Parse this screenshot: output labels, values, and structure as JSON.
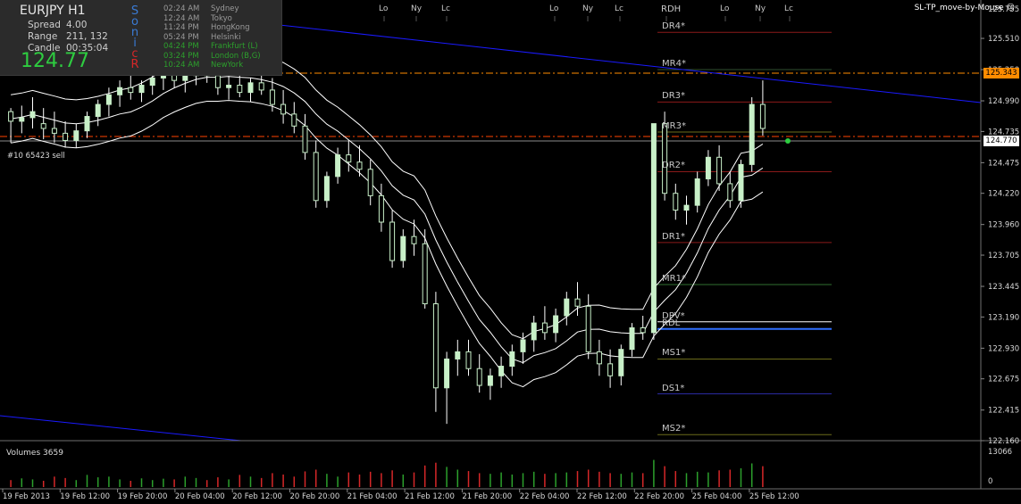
{
  "window": {
    "ea_name": "SL-TP_move-by-Mouse",
    "ea_icon": "smiley-icon"
  },
  "info_panel": {
    "symbol": "EURJPY  H1",
    "spread_label": "Spread",
    "spread_value": "4.00",
    "range_label": "Range",
    "range_value": "211, 132",
    "candle_label": "Candle",
    "candle_value": "00:35:04",
    "bid": "124.77",
    "sonic_letters": [
      {
        "ch": "S",
        "color": "#3a7bd5"
      },
      {
        "ch": "o",
        "color": "#3a7bd5"
      },
      {
        "ch": "n",
        "color": "#3a7bd5"
      },
      {
        "ch": "i",
        "color": "#3a7bd5"
      },
      {
        "ch": "c",
        "color": "#d62728"
      },
      {
        "ch": "R",
        "color": "#d62728"
      }
    ]
  },
  "sessions": [
    {
      "time": "02:24 AM",
      "city": "Sydney",
      "active": false
    },
    {
      "time": "12:24 AM",
      "city": "Tokyo",
      "active": false
    },
    {
      "time": "11:24 PM",
      "city": "HongKong",
      "active": false
    },
    {
      "time": "05:24 PM",
      "city": "Helsinki",
      "active": false
    },
    {
      "time": "04:24 PM",
      "city": "Frankfurt  (L)",
      "active": true
    },
    {
      "time": "03:24 PM",
      "city": "London  (B,G)",
      "active": true
    },
    {
      "time": "10:24 AM",
      "city": "NewYork",
      "active": true
    }
  ],
  "session_tags": [
    "Lo",
    "Ny",
    "Lc",
    "Lo",
    "Ny",
    "Lc",
    "RDH",
    "Lo",
    "Ny",
    "Lc"
  ],
  "order_label": "#10 65423 sell",
  "current_price_label": "124.770",
  "order_price_label": "125.343",
  "pivot_levels": [
    {
      "label": "DR4*",
      "price": 125.56,
      "color": "#8b1a1a"
    },
    {
      "label": "MR4*",
      "price": 125.25,
      "color": "#2f4f2f"
    },
    {
      "label": "DR3*",
      "price": 124.98,
      "color": "#8b1a1a"
    },
    {
      "label": "MR3*",
      "price": 124.73,
      "color": "#6b6b1a"
    },
    {
      "label": "DR2*",
      "price": 124.4,
      "color": "#8b1a1a"
    },
    {
      "label": "DR1*",
      "price": 123.81,
      "color": "#8b1a1a"
    },
    {
      "label": "MR1*",
      "price": 123.46,
      "color": "#2f6f2f"
    },
    {
      "label": "DPV*",
      "price": 123.15,
      "color": "#ffffff"
    },
    {
      "label": "RDL",
      "price": 123.09,
      "color": "#2f6fff"
    },
    {
      "label": "MS1*",
      "price": 122.84,
      "color": "#6b6b1a"
    },
    {
      "label": "DS1*",
      "price": 122.55,
      "color": "#2a2aa0"
    },
    {
      "label": "MS2*",
      "price": 122.21,
      "color": "#6b6b1a"
    }
  ],
  "price_axis": [
    "125.755",
    "125.510",
    "125.250",
    "124.990",
    "124.735",
    "124.475",
    "124.220",
    "123.960",
    "123.705",
    "123.445",
    "123.190",
    "122.930",
    "122.675",
    "122.415",
    "122.160"
  ],
  "volume_axis": [
    "13066",
    "0"
  ],
  "volume_label": "Volumes 3659",
  "time_axis": [
    "19 Feb 2013",
    "19 Feb 12:00",
    "19 Feb 20:00",
    "20 Feb 04:00",
    "20 Feb 12:00",
    "20 Feb 20:00",
    "21 Feb 04:00",
    "21 Feb 12:00",
    "21 Feb 20:00",
    "22 Feb 04:00",
    "22 Feb 12:00",
    "22 Feb 20:00",
    "25 Feb 04:00",
    "25 Feb 12:00"
  ],
  "colors": {
    "bull": "#c8f0c8",
    "bear": "#c8f0c8",
    "wick": "#ffffff",
    "band": "#ffffff",
    "trend": "#1a1aff",
    "vol_up": "#2ca02c",
    "vol_down": "#d62728",
    "bid_line": "#ff4500",
    "order_line": "#ff8c00"
  },
  "chart_data": {
    "type": "candlestick",
    "symbol": "EURJPY",
    "timeframe": "H1",
    "ylim": [
      122.16,
      125.8
    ],
    "candles": [
      [
        124.9,
        124.93,
        124.64,
        124.82
      ],
      [
        124.82,
        124.95,
        124.72,
        124.85
      ],
      [
        124.85,
        125.02,
        124.76,
        124.9
      ],
      [
        124.8,
        124.93,
        124.67,
        124.76
      ],
      [
        124.76,
        124.9,
        124.64,
        124.72
      ],
      [
        124.72,
        124.82,
        124.6,
        124.66
      ],
      [
        124.66,
        124.8,
        124.6,
        124.74
      ],
      [
        124.74,
        124.9,
        124.68,
        124.86
      ],
      [
        124.86,
        125.0,
        124.78,
        124.96
      ],
      [
        124.96,
        125.1,
        124.86,
        125.04
      ],
      [
        125.04,
        125.16,
        124.94,
        125.1
      ],
      [
        125.1,
        125.2,
        125.0,
        125.06
      ],
      [
        125.06,
        125.16,
        124.98,
        125.12
      ],
      [
        125.12,
        125.24,
        125.04,
        125.18
      ],
      [
        125.18,
        125.28,
        125.08,
        125.22
      ],
      [
        125.22,
        125.3,
        125.1,
        125.16
      ],
      [
        125.16,
        125.26,
        125.06,
        125.2
      ],
      [
        125.2,
        125.32,
        125.12,
        125.26
      ],
      [
        125.26,
        125.34,
        125.14,
        125.2
      ],
      [
        125.2,
        125.28,
        125.04,
        125.1
      ],
      [
        125.1,
        125.2,
        125.0,
        125.12
      ],
      [
        125.12,
        125.22,
        125.02,
        125.06
      ],
      [
        125.06,
        125.18,
        124.98,
        125.14
      ],
      [
        125.14,
        125.24,
        125.04,
        125.08
      ],
      [
        125.08,
        125.18,
        124.9,
        124.96
      ],
      [
        124.96,
        125.08,
        124.8,
        124.88
      ],
      [
        124.88,
        124.98,
        124.72,
        124.78
      ],
      [
        124.78,
        124.88,
        124.5,
        124.56
      ],
      [
        124.56,
        124.66,
        124.1,
        124.16
      ],
      [
        124.16,
        124.4,
        124.1,
        124.36
      ],
      [
        124.36,
        124.6,
        124.3,
        124.54
      ],
      [
        124.54,
        124.66,
        124.4,
        124.48
      ],
      [
        124.48,
        124.62,
        124.36,
        124.42
      ],
      [
        124.42,
        124.5,
        124.12,
        124.2
      ],
      [
        124.2,
        124.3,
        123.9,
        123.98
      ],
      [
        123.98,
        124.08,
        123.6,
        123.66
      ],
      [
        123.66,
        123.92,
        123.6,
        123.86
      ],
      [
        123.86,
        124.0,
        123.7,
        123.8
      ],
      [
        123.8,
        123.92,
        123.26,
        123.3
      ],
      [
        123.3,
        123.4,
        122.4,
        122.6
      ],
      [
        122.6,
        122.9,
        122.3,
        122.84
      ],
      [
        122.84,
        123.0,
        122.7,
        122.9
      ],
      [
        122.9,
        123.0,
        122.7,
        122.76
      ],
      [
        122.76,
        122.88,
        122.56,
        122.62
      ],
      [
        122.62,
        122.76,
        122.5,
        122.7
      ],
      [
        122.7,
        122.86,
        122.6,
        122.78
      ],
      [
        122.78,
        122.96,
        122.7,
        122.9
      ],
      [
        122.9,
        123.06,
        122.8,
        123.0
      ],
      [
        123.0,
        123.2,
        122.9,
        123.14
      ],
      [
        123.14,
        123.28,
        123.0,
        123.06
      ],
      [
        123.06,
        123.26,
        122.98,
        123.2
      ],
      [
        123.2,
        123.4,
        123.12,
        123.34
      ],
      [
        123.34,
        123.48,
        123.2,
        123.28
      ],
      [
        123.28,
        123.38,
        122.84,
        122.9
      ],
      [
        122.9,
        123.0,
        122.7,
        122.8
      ],
      [
        122.8,
        122.92,
        122.6,
        122.7
      ],
      [
        122.7,
        122.96,
        122.62,
        122.92
      ],
      [
        122.92,
        123.14,
        122.86,
        123.1
      ],
      [
        123.1,
        123.2,
        123.0,
        123.06
      ],
      [
        123.06,
        123.46,
        123.0,
        124.8
      ],
      [
        124.8,
        124.9,
        124.16,
        124.22
      ],
      [
        124.22,
        124.3,
        124.0,
        124.08
      ],
      [
        124.08,
        124.2,
        123.96,
        124.12
      ],
      [
        124.12,
        124.4,
        124.06,
        124.34
      ],
      [
        124.34,
        124.58,
        124.28,
        124.52
      ],
      [
        124.52,
        124.62,
        124.24,
        124.3
      ],
      [
        124.3,
        124.4,
        124.1,
        124.16
      ],
      [
        124.16,
        124.5,
        124.1,
        124.46
      ],
      [
        124.46,
        125.02,
        124.4,
        124.96
      ],
      [
        124.96,
        125.16,
        124.7,
        124.76
      ]
    ],
    "volumes": [
      0.2,
      0.25,
      0.22,
      0.18,
      0.3,
      0.26,
      0.2,
      0.35,
      0.28,
      0.3,
      0.22,
      0.18,
      0.25,
      0.2,
      0.24,
      0.22,
      0.3,
      0.26,
      0.2,
      0.28,
      0.22,
      0.35,
      0.3,
      0.26,
      0.4,
      0.36,
      0.3,
      0.45,
      0.5,
      0.38,
      0.3,
      0.42,
      0.36,
      0.44,
      0.4,
      0.48,
      0.36,
      0.42,
      0.62,
      0.7,
      0.58,
      0.5,
      0.46,
      0.4,
      0.38,
      0.42,
      0.36,
      0.4,
      0.44,
      0.38,
      0.4,
      0.42,
      0.46,
      0.5,
      0.44,
      0.4,
      0.38,
      0.42,
      0.4,
      0.78,
      0.6,
      0.46,
      0.4,
      0.44,
      0.42,
      0.48,
      0.5,
      0.54,
      0.68,
      0.6
    ]
  }
}
